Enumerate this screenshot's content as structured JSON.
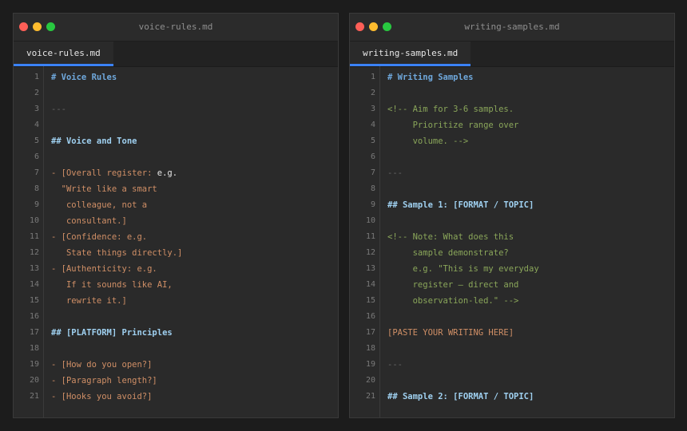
{
  "windows": [
    {
      "title": "voice-rules.md",
      "tab": "voice-rules.md",
      "lines": [
        {
          "n": "1",
          "kind": "h1",
          "text": "# Voice Rules"
        },
        {
          "n": "2",
          "kind": "blank",
          "text": ""
        },
        {
          "n": "3",
          "kind": "hr",
          "text": "---"
        },
        {
          "n": "4",
          "kind": "blank",
          "text": ""
        },
        {
          "n": "5",
          "kind": "h2",
          "text": "## Voice and Tone"
        },
        {
          "n": "6",
          "kind": "blank",
          "text": ""
        },
        {
          "n": "7",
          "kind": "mixed",
          "segments": [
            {
              "kind": "bullet",
              "text": "- [Overall register: "
            },
            {
              "kind": "plain",
              "text": "e.g."
            }
          ]
        },
        {
          "n": "8",
          "kind": "ph",
          "text": "  \"Write like a smart"
        },
        {
          "n": "9",
          "kind": "ph",
          "text": "   colleague, not a"
        },
        {
          "n": "10",
          "kind": "ph",
          "text": "   consultant.]"
        },
        {
          "n": "11",
          "kind": "bullet",
          "text": "- [Confidence: e.g."
        },
        {
          "n": "12",
          "kind": "ph",
          "text": "   State things directly.]"
        },
        {
          "n": "13",
          "kind": "bullet",
          "text": "- [Authenticity: e.g."
        },
        {
          "n": "14",
          "kind": "ph",
          "text": "   If it sounds like AI,"
        },
        {
          "n": "15",
          "kind": "ph",
          "text": "   rewrite it.]"
        },
        {
          "n": "16",
          "kind": "blank",
          "text": ""
        },
        {
          "n": "17",
          "kind": "h2",
          "text": "## [PLATFORM] Principles"
        },
        {
          "n": "18",
          "kind": "blank",
          "text": ""
        },
        {
          "n": "19",
          "kind": "bullet",
          "text": "- [How do you open?]"
        },
        {
          "n": "20",
          "kind": "bullet",
          "text": "- [Paragraph length?]"
        },
        {
          "n": "21",
          "kind": "bullet",
          "text": "- [Hooks you avoid?]"
        }
      ]
    },
    {
      "title": "writing-samples.md",
      "tab": "writing-samples.md",
      "lines": [
        {
          "n": "1",
          "kind": "h1",
          "text": "# Writing Samples"
        },
        {
          "n": "2",
          "kind": "blank",
          "text": ""
        },
        {
          "n": "3",
          "kind": "comment",
          "text": "<!-- Aim for 3-6 samples."
        },
        {
          "n": "4",
          "kind": "comment",
          "text": "     Prioritize range over"
        },
        {
          "n": "5",
          "kind": "comment",
          "text": "     volume. -->"
        },
        {
          "n": "6",
          "kind": "blank",
          "text": ""
        },
        {
          "n": "7",
          "kind": "hr",
          "text": "---"
        },
        {
          "n": "8",
          "kind": "blank",
          "text": ""
        },
        {
          "n": "9",
          "kind": "h2",
          "text": "## Sample 1: [FORMAT / TOPIC]"
        },
        {
          "n": "10",
          "kind": "blank",
          "text": ""
        },
        {
          "n": "11",
          "kind": "comment",
          "text": "<!-- Note: What does this"
        },
        {
          "n": "12",
          "kind": "comment",
          "text": "     sample demonstrate?"
        },
        {
          "n": "13",
          "kind": "comment",
          "text": "     e.g. \"This is my everyday"
        },
        {
          "n": "14",
          "kind": "comment",
          "text": "     register — direct and"
        },
        {
          "n": "15",
          "kind": "comment",
          "text": "     observation-led.\" -->"
        },
        {
          "n": "16",
          "kind": "blank",
          "text": ""
        },
        {
          "n": "17",
          "kind": "ph",
          "text": "[PASTE YOUR WRITING HERE]"
        },
        {
          "n": "18",
          "kind": "blank",
          "text": ""
        },
        {
          "n": "19",
          "kind": "hr",
          "text": "---"
        },
        {
          "n": "20",
          "kind": "blank",
          "text": ""
        },
        {
          "n": "21",
          "kind": "h2",
          "text": "## Sample 2: [FORMAT / TOPIC]"
        }
      ]
    }
  ]
}
